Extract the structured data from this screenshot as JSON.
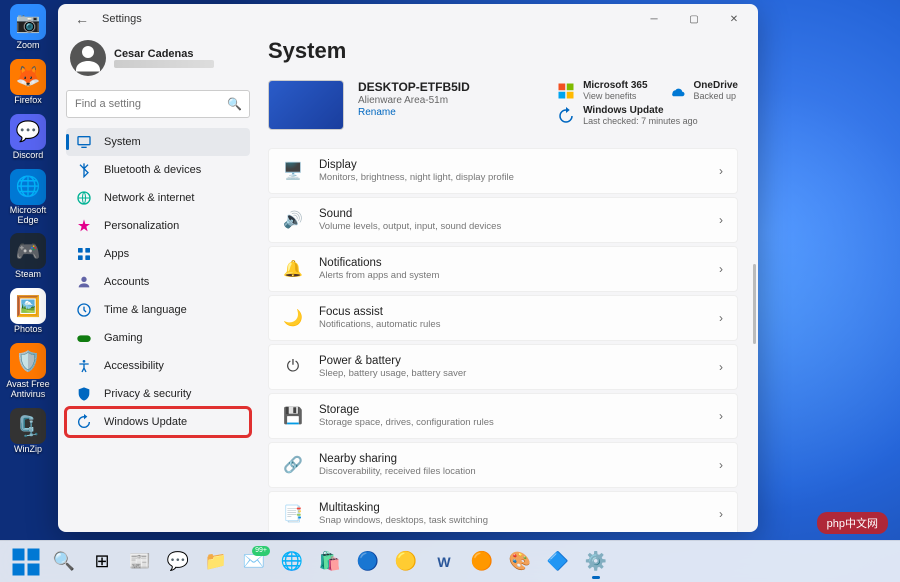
{
  "desktop": {
    "icons": [
      {
        "label": "Zoom",
        "color": "#2d8cff",
        "emoji": "📷"
      },
      {
        "label": "Firefox",
        "color": "#ff7a00",
        "emoji": "🦊"
      },
      {
        "label": "Discord",
        "color": "#5865f2",
        "emoji": "💬"
      },
      {
        "label": "Microsoft Edge",
        "color": "#0078d4",
        "emoji": "🌐"
      },
      {
        "label": "Steam",
        "color": "#1b2838",
        "emoji": "🎮"
      },
      {
        "label": "Photos",
        "color": "#fff",
        "emoji": "🖼️"
      },
      {
        "label": "Avast Free Antivirus",
        "color": "#ff7800",
        "emoji": "🛡️"
      },
      {
        "label": "WinZip",
        "color": "#333",
        "emoji": "🗜️"
      }
    ]
  },
  "window": {
    "title": "Settings",
    "user": {
      "name": "Cesar Cadenas"
    },
    "search": {
      "placeholder": "Find a setting"
    },
    "nav": [
      {
        "icon": "system",
        "label": "System",
        "color": "#0067c0",
        "active": true
      },
      {
        "icon": "bluetooth",
        "label": "Bluetooth & devices",
        "color": "#0067c0"
      },
      {
        "icon": "network",
        "label": "Network & internet",
        "color": "#00b294"
      },
      {
        "icon": "personalize",
        "label": "Personalization",
        "color": "#e3008c"
      },
      {
        "icon": "apps",
        "label": "Apps",
        "color": "#0067c0"
      },
      {
        "icon": "accounts",
        "label": "Accounts",
        "color": "#6264a7"
      },
      {
        "icon": "time",
        "label": "Time & language",
        "color": "#0067c0"
      },
      {
        "icon": "gaming",
        "label": "Gaming",
        "color": "#107c10"
      },
      {
        "icon": "accessibility",
        "label": "Accessibility",
        "color": "#0067c0"
      },
      {
        "icon": "privacy",
        "label": "Privacy & security",
        "color": "#0067c0"
      },
      {
        "icon": "update",
        "label": "Windows Update",
        "color": "#0067c0",
        "highlighted": true
      }
    ],
    "main": {
      "heading": "System",
      "device": {
        "name": "DESKTOP-ETFB5ID",
        "model": "Alienware Area-51m",
        "rename": "Rename"
      },
      "status": [
        {
          "title": "Microsoft 365",
          "sub": "View benefits",
          "icon": "m365"
        },
        {
          "title": "OneDrive",
          "sub": "Backed up",
          "icon": "onedrive"
        },
        {
          "title": "Windows Update",
          "sub": "Last checked: 7 minutes ago",
          "icon": "update-status",
          "span": 2
        }
      ],
      "cards": [
        {
          "icon": "🖥️",
          "title": "Display",
          "sub": "Monitors, brightness, night light, display profile"
        },
        {
          "icon": "🔊",
          "title": "Sound",
          "sub": "Volume levels, output, input, sound devices"
        },
        {
          "icon": "🔔",
          "title": "Notifications",
          "sub": "Alerts from apps and system"
        },
        {
          "icon": "🌙",
          "title": "Focus assist",
          "sub": "Notifications, automatic rules"
        },
        {
          "icon": "⏻",
          "title": "Power & battery",
          "sub": "Sleep, battery usage, battery saver"
        },
        {
          "icon": "💾",
          "title": "Storage",
          "sub": "Storage space, drives, configuration rules"
        },
        {
          "icon": "🔗",
          "title": "Nearby sharing",
          "sub": "Discoverability, received files location"
        },
        {
          "icon": "📑",
          "title": "Multitasking",
          "sub": "Snap windows, desktops, task switching"
        }
      ]
    }
  },
  "taskbar": {
    "badge": "99+"
  },
  "watermark": "php中文网"
}
